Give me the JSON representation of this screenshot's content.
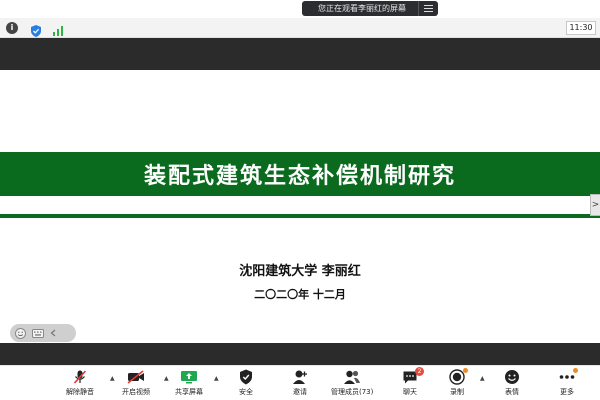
{
  "viewing_banner": {
    "text": "您正在观看李丽红的屏幕",
    "menu_icon": "menu-icon"
  },
  "status_bar": {
    "time": "11:30",
    "icons": [
      "info-icon",
      "shield-icon",
      "signal-icon"
    ]
  },
  "slide": {
    "title": "装配式建筑生态补偿机制研究",
    "author_line": "沈阳建筑大学  李丽红",
    "date_line": "二〇二〇年 十二月",
    "side_tab_glyph": ">"
  },
  "toolbar": {
    "items": [
      {
        "label": "解除静音",
        "icon": "microphone-muted-icon"
      },
      {
        "label": "开启视频",
        "icon": "camera-off-icon"
      },
      {
        "label": "共享屏幕",
        "icon": "share-screen-icon"
      },
      {
        "label": "安全",
        "icon": "security-shield-icon"
      },
      {
        "label": "邀请",
        "icon": "invite-user-icon"
      },
      {
        "label": "管理成员(73)",
        "icon": "members-icon"
      },
      {
        "label": "聊天",
        "icon": "chat-icon",
        "badge": "2"
      },
      {
        "label": "录制",
        "icon": "record-icon"
      },
      {
        "label": "表情",
        "icon": "emoji-icon"
      },
      {
        "label": "更多",
        "icon": "more-icon"
      }
    ]
  },
  "colors": {
    "title_green": "#0a6b1f",
    "dark_band": "#2b2b2b",
    "badge_red": "#e74c3c",
    "accent_orange": "#f08a24"
  }
}
